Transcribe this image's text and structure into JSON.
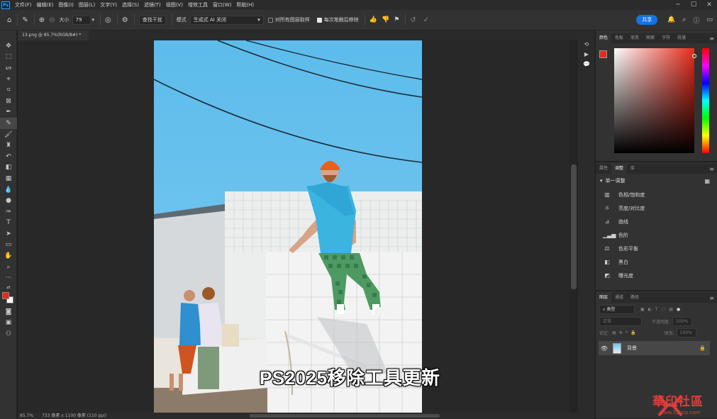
{
  "menubar": {
    "logo": "Ps",
    "items": [
      "文件(F)",
      "编辑(E)",
      "图像(I)",
      "图层(L)",
      "文字(Y)",
      "选择(S)",
      "滤镜(T)",
      "视图(V)",
      "增效工具",
      "窗口(W)",
      "帮助(H)"
    ]
  },
  "options": {
    "size_label": "大小",
    "size_value": "79",
    "find_distractions": "查找干扰",
    "mode_label": "模式",
    "mode_value": "生成式 AI 关闭",
    "sample_all_layers": "对所有图层取样",
    "remove_after_stroke": "每次笔触后移除",
    "share_label": "共享"
  },
  "document": {
    "tab_title": "13.png @ 85.7%(RGB/8#) *",
    "zoom": "85.7%",
    "dimensions": "733 像素 x 1100 像素 (110 ppi)"
  },
  "caption": "PS2025移除工具更新",
  "watermark": {
    "text": "華印社區",
    "url": "www.52cnp.com"
  },
  "color_panel": {
    "tabs": [
      "颜色",
      "色板",
      "渐变",
      "图案",
      "字符",
      "段落"
    ],
    "foreground": "#e8291c",
    "background": "#ffffff"
  },
  "adjust_panel": {
    "tabs": [
      "属性",
      "调整",
      "库"
    ],
    "section": "单一调整",
    "items": [
      "色相/饱和度",
      "亮度/对比度",
      "曲线",
      "色阶",
      "色彩平衡",
      "黑白",
      "曝光度"
    ]
  },
  "layers_panel": {
    "tabs": [
      "图层",
      "通道",
      "路径"
    ],
    "search_placeholder": "类型",
    "blend_mode": "正常",
    "opacity_label": "不透明度:",
    "opacity_value": "100%",
    "lock_label": "锁定:",
    "fill_label": "填充:",
    "fill_value": "100%",
    "layer_name": "背景"
  }
}
